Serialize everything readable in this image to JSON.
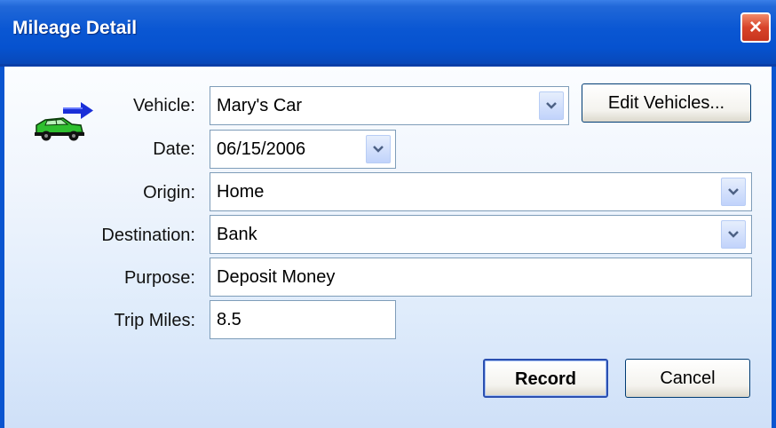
{
  "window": {
    "title": "Mileage Detail",
    "close_label": "×"
  },
  "form": {
    "vehicle_label": "Vehicle:",
    "vehicle_value": "Mary's Car",
    "edit_vehicles_label": "Edit Vehicles...",
    "date_label": "Date:",
    "date_value": "06/15/2006",
    "origin_label": "Origin:",
    "origin_value": "Home",
    "destination_label": "Destination:",
    "destination_value": "Bank",
    "purpose_label": "Purpose:",
    "purpose_value": "Deposit Money",
    "trip_miles_label": "Trip Miles:",
    "trip_miles_value": "8.5"
  },
  "actions": {
    "record_label": "Record",
    "cancel_label": "Cancel"
  },
  "icons": {
    "app_icon": "car-with-arrow-icon",
    "dropdown": "chevron-down-icon",
    "close": "close-icon"
  },
  "colors": {
    "titlebar": "#0652cf",
    "close_button": "#d8432a",
    "client_bg_top": "#fbfdff",
    "client_bg_bottom": "#cfe0f8",
    "car_body": "#2fbf2f",
    "arrow": "#1a2fd8"
  }
}
